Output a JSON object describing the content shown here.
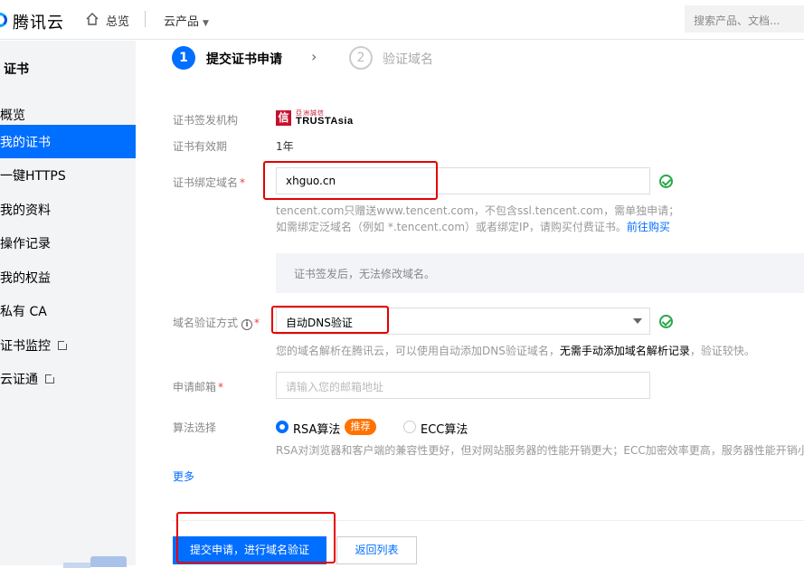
{
  "topbar": {
    "brand": "腾讯云",
    "overview": "总览",
    "products": "云产品",
    "search_placeholder": "搜索产品、文档..."
  },
  "sidebar": {
    "title": "证书",
    "items": [
      {
        "label": "概览"
      },
      {
        "label": "我的证书"
      },
      {
        "label": "一键HTTPS"
      },
      {
        "label": "我的资料"
      },
      {
        "label": "操作记录"
      },
      {
        "label": "我的权益"
      },
      {
        "label": "私有 CA"
      },
      {
        "label": "证书监控"
      },
      {
        "label": "云证通"
      }
    ]
  },
  "steps": [
    {
      "num": "1",
      "label": "提交证书申请"
    },
    {
      "num": "2",
      "label": "验证域名"
    }
  ],
  "form": {
    "issuer_label": "证书签发机构",
    "issuer_brand_cn": "亞洲誠信",
    "issuer_brand_en": "TRUSTAsia",
    "validity_label": "证书有效期",
    "validity_value": "1年",
    "domain_label": "证书绑定域名",
    "domain_value": "xhguo.cn",
    "domain_help_1": "tencent.com只赠送www.tencent.com，不包含ssl.tencent.com，需单独申请；",
    "domain_help_2": "如需绑定泛域名（例如 *.tencent.com）或者绑定IP，请购买付费证书。",
    "domain_help_link": "前往购买",
    "notice": "证书签发后，无法修改域名。",
    "verify_label": "域名验证方式",
    "verify_value": "自动DNS验证",
    "verify_help_1": "您的域名解析在腾讯云，可以使用自动添加DNS验证域名，",
    "verify_help_strong": "无需手动添加域名解析记录",
    "verify_help_2": "，验证较快。",
    "email_label": "申请邮箱",
    "email_placeholder": "请输入您的邮箱地址",
    "algo_label": "算法选择",
    "algo_rsa": "RSA算法",
    "algo_badge": "推荐",
    "algo_ecc": "ECC算法",
    "algo_help": "RSA对浏览器和客户端的兼容性更好，但对网站服务器的性能开销更大；ECC加密效率更高，服务器性能开销小优",
    "more": "更多"
  },
  "actions": {
    "submit": "提交申请，进行域名验证",
    "back": "返回列表"
  },
  "colors": {
    "primary": "#006eff",
    "highlight": "#e50000",
    "success": "#29a745",
    "badge": "#ff7200"
  }
}
